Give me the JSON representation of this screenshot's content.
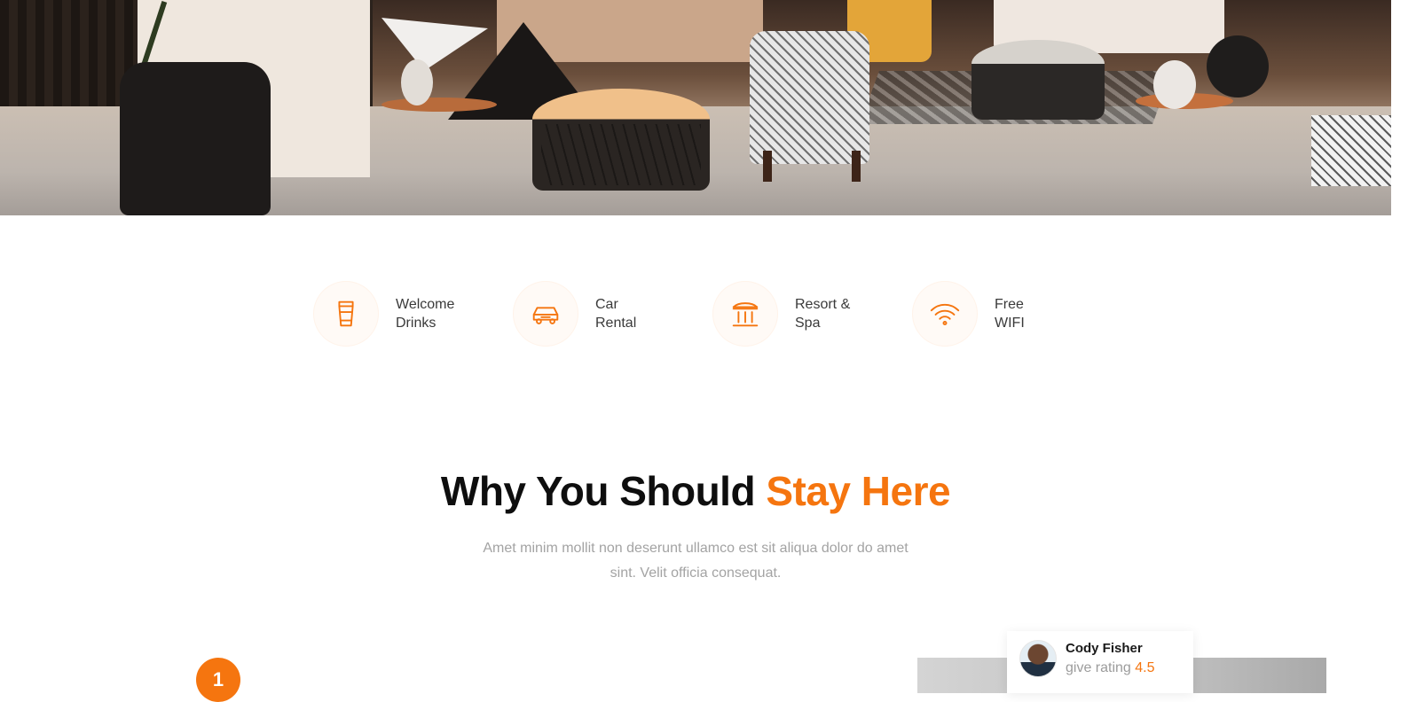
{
  "amenities": [
    {
      "icon": "drink-cup-icon",
      "line1": "Welcome",
      "line2": "Drinks"
    },
    {
      "icon": "car-icon",
      "line1": "Car",
      "line2": "Rental"
    },
    {
      "icon": "spa-building-icon",
      "line1": "Resort &",
      "line2": "Spa"
    },
    {
      "icon": "wifi-icon",
      "line1": "Free",
      "line2": "WIFI"
    }
  ],
  "section": {
    "title_main": "Why You Should ",
    "title_accent": "Stay Here",
    "subtitle": "Amet minim mollit non deserunt ullamco est sit aliqua dolor do amet sint. Velit officia consequat."
  },
  "steps": {
    "first_number": "1"
  },
  "review": {
    "name": "Cody Fisher",
    "rating_prefix": "give rating ",
    "rating_value": "4.5"
  },
  "colors": {
    "accent": "#f5750f",
    "text_dark": "#0e0e0e",
    "text_muted": "#a3a3a3"
  }
}
